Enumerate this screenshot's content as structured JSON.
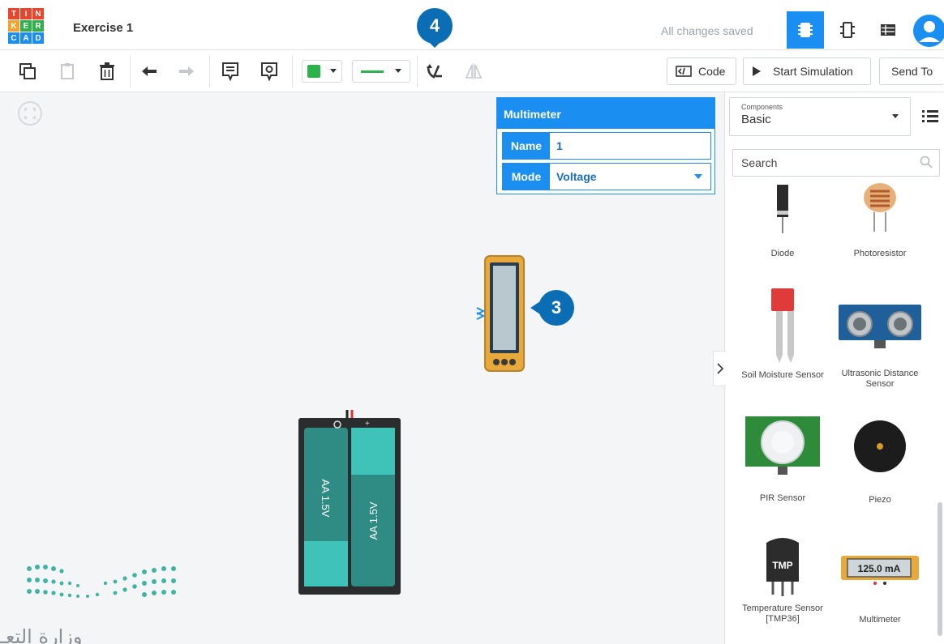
{
  "app": {
    "logo_letters": [
      "T",
      "I",
      "N",
      "K",
      "E",
      "R",
      "C",
      "A",
      "D"
    ],
    "title": "Exercise 1",
    "status": "All changes saved"
  },
  "toolbar": {
    "code_label": "Code",
    "start_simulation_label": "Start Simulation",
    "send_to_label": "Send To"
  },
  "badges": {
    "four": "4",
    "three": "3"
  },
  "inspector": {
    "header": "Multimeter",
    "name_label": "Name",
    "name_value": "1",
    "mode_label": "Mode",
    "mode_value": "Voltage"
  },
  "panel": {
    "components_label": "Components",
    "components_value": "Basic",
    "search_placeholder": "Search",
    "items": [
      {
        "label": "Diode"
      },
      {
        "label": "Photoresistor"
      },
      {
        "label": "Soil Moisture Sensor"
      },
      {
        "label": "Ultrasonic Distance Sensor"
      },
      {
        "label": "PIR Sensor"
      },
      {
        "label": "Piezo"
      },
      {
        "label": "Temperature Sensor [TMP36]"
      },
      {
        "label": "Multimeter"
      }
    ],
    "tmp_chip_text": "TMP",
    "multimeter_reading": "125.0 mA"
  },
  "battery": {
    "label": "AA 1.5V"
  },
  "footer": {
    "arabic_text": "وزارة التعـ"
  },
  "colors": {
    "accent": "#1b8ff1",
    "badge": "#0b6db3",
    "battery_case": "#2a2c2e",
    "battery_cell": "#2f8c84",
    "multimeter_body": "#e7a93b",
    "color_swatch": "#29b34a"
  }
}
